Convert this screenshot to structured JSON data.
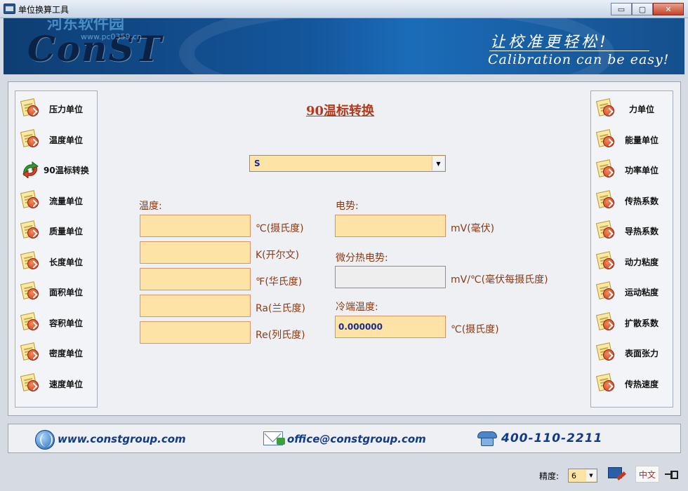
{
  "window": {
    "title": "单位换算工具",
    "min_glyph": "▭",
    "max_glyph": "▢",
    "close_glyph": "✕"
  },
  "banner": {
    "logo": "ConST",
    "slogan_cn": "让校准更轻松!",
    "slogan_en": "Calibration can be easy!",
    "watermark": "河东软件园",
    "watermark_sub": "www.pc0359.cn"
  },
  "left_nav": [
    {
      "label": "压力单位",
      "icon": "document-arrow-icon"
    },
    {
      "label": "温度单位",
      "icon": "document-arrow-icon"
    },
    {
      "label": "90温标转换",
      "icon": "refresh-arrow-icon",
      "active": true
    },
    {
      "label": "流量单位",
      "icon": "document-arrow-icon"
    },
    {
      "label": "质量单位",
      "icon": "document-arrow-icon"
    },
    {
      "label": "长度单位",
      "icon": "document-arrow-icon"
    },
    {
      "label": "面积单位",
      "icon": "document-arrow-icon"
    },
    {
      "label": "容积单位",
      "icon": "document-arrow-icon"
    },
    {
      "label": "密度单位",
      "icon": "document-arrow-icon"
    },
    {
      "label": "速度单位",
      "icon": "document-arrow-icon"
    }
  ],
  "right_nav": [
    {
      "label": "力单位",
      "icon": "document-arrow-icon"
    },
    {
      "label": "能量单位",
      "icon": "document-arrow-icon"
    },
    {
      "label": "功率单位",
      "icon": "document-arrow-icon"
    },
    {
      "label": "传热系数",
      "icon": "document-arrow-icon"
    },
    {
      "label": "导热系数",
      "icon": "document-arrow-icon"
    },
    {
      "label": "动力粘度",
      "icon": "document-arrow-icon"
    },
    {
      "label": "运动粘度",
      "icon": "document-arrow-icon"
    },
    {
      "label": "扩散系数",
      "icon": "document-arrow-icon"
    },
    {
      "label": "表面张力",
      "icon": "document-arrow-icon"
    },
    {
      "label": "传热速度",
      "icon": "document-arrow-icon"
    }
  ],
  "panel": {
    "title": "90温标转换",
    "thermocouple_type": "S",
    "temperature_label": "温度:",
    "temperature_fields": [
      {
        "value": "",
        "unit": "℃(摄氏度)"
      },
      {
        "value": "",
        "unit": "K(开尔文)"
      },
      {
        "value": "",
        "unit": "℉(华氏度)"
      },
      {
        "value": "",
        "unit": "Ra(兰氏度)"
      },
      {
        "value": "",
        "unit": "Re(列氏度)"
      }
    ],
    "emf_label": "电势:",
    "emf": {
      "value": "",
      "unit": "mV(毫伏)"
    },
    "diff_emf_label": "微分热电势:",
    "diff_emf": {
      "value": "",
      "unit": "mV/℃(毫伏每摄氏度)"
    },
    "cold_junction_label": "冷端温度:",
    "cold_junction": {
      "value": "0.000000",
      "unit": "℃(摄氏度)"
    }
  },
  "footer": {
    "website": "www.constgroup.com",
    "email": "office@constgroup.com",
    "phone": "400-110-2211"
  },
  "statusbar": {
    "precision_label": "精度:",
    "precision_value": "6",
    "language": "中文"
  },
  "colors": {
    "field_bg": "#fde4a6",
    "label_color": "#8a3a14",
    "title_color": "#b23a1a",
    "banner_blue": "#14569c"
  }
}
